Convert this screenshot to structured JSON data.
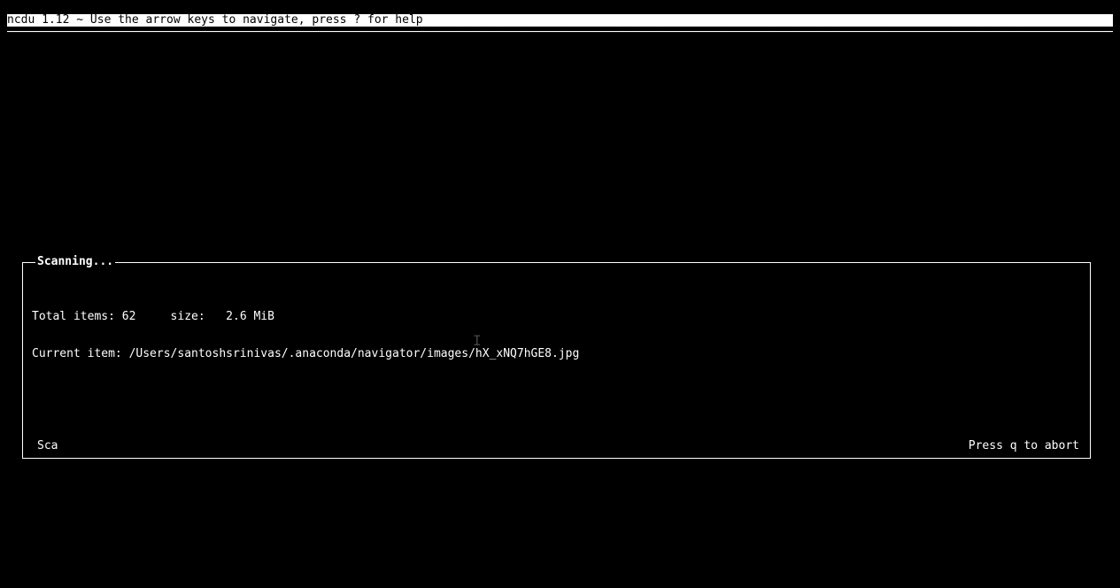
{
  "header": {
    "text": "ncdu 1.12 ~ Use the arrow keys to navigate, press ? for help"
  },
  "divider": "───────────────────────────────────────────────────────────────────────────────────────────────────────────────────────────────────────────────────────────────────────────────────────────────────────────────────────────────────────────────────────────────────────",
  "scanbox": {
    "title": "Scanning...",
    "items_label": "Total items:",
    "items_value": "62",
    "size_label": "size:",
    "size_value": "2.6 MiB",
    "current_label": "Current item:",
    "current_value": "/Users/santoshsrinivas/.anaconda/navigator/images/hX_xNQ7hGE8.jpg",
    "footer_left": "Sca",
    "footer_right": "Press q to abort"
  }
}
